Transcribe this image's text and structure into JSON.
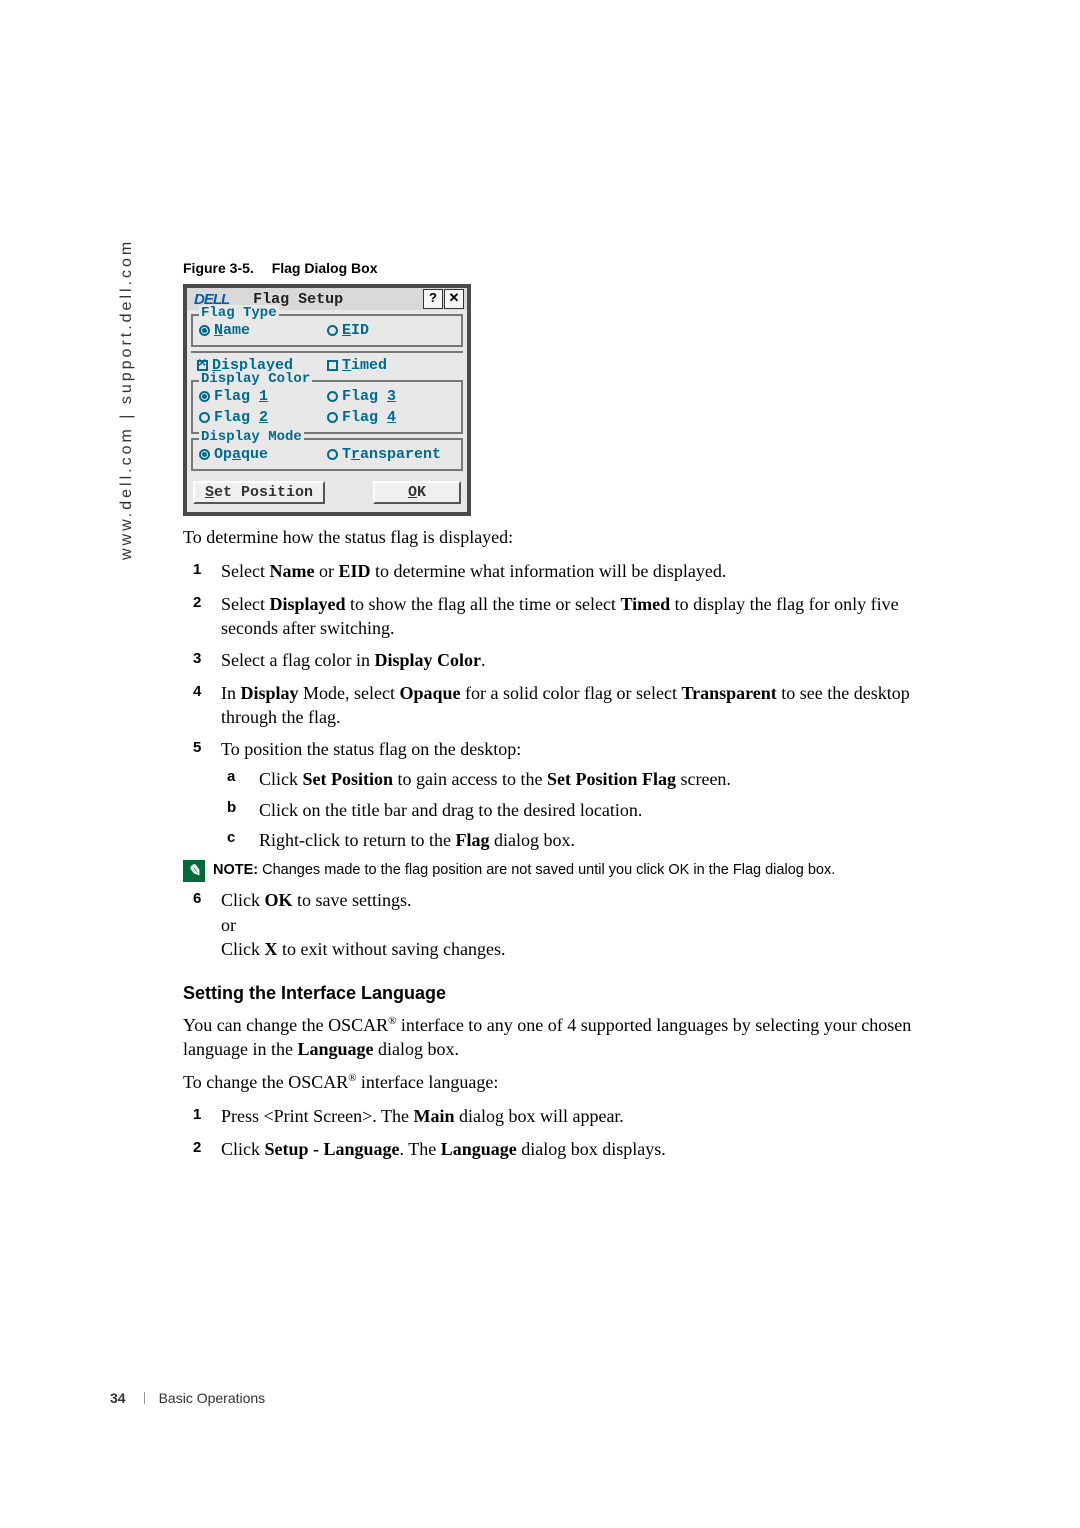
{
  "sidebar": "www.dell.com | support.dell.com",
  "figure": {
    "num": "Figure 3-5.",
    "title": "Flag Dialog Box"
  },
  "dialog": {
    "logo": "DELL",
    "title": "Flag Setup",
    "help": "?",
    "close": "✕",
    "flagType": {
      "legend": "Flag Type",
      "name_pre": "",
      "name_u": "N",
      "name_post": "ame",
      "eid_pre": "",
      "eid_u": "E",
      "eid_post": "ID",
      "disp_pre": "",
      "disp_u": "D",
      "disp_post": "isplayed",
      "timed_pre": "",
      "timed_u": "T",
      "timed_post": "imed"
    },
    "displayColor": {
      "legend": "Display Color",
      "f1": "Flag ",
      "n1": "1",
      "f2": "Flag ",
      "n2": "2",
      "f3": "Flag ",
      "n3": "3",
      "f4": "Flag ",
      "n4": "4"
    },
    "displayMode": {
      "legend": "Display Mode",
      "opaque_pre": "Op",
      "opaque_u": "a",
      "opaque_post": "que",
      "trans_pre": "T",
      "trans_u": "r",
      "trans_post": "ansparent"
    },
    "setPos_pre": "",
    "setPos_u": "S",
    "setPos_post": "et Position",
    "ok_pre": "",
    "ok_u": "O",
    "ok_post": "K"
  },
  "intro": "To determine how the status flag is displayed:",
  "steps": {
    "s1a": "Select ",
    "s1b": "Name",
    "s1c": " or ",
    "s1d": "EID",
    "s1e": " to determine what information will be displayed.",
    "s2a": "Select ",
    "s2b": "Displayed",
    "s2c": " to show the flag all the time or select ",
    "s2d": "Timed",
    "s2e": " to display the flag for only five seconds after switching.",
    "s3a": "Select a flag color in ",
    "s3b": "Display Color",
    "s3c": ".",
    "s4a": "In ",
    "s4b": "Display",
    "s4c": " Mode, select ",
    "s4d": "Opaque",
    "s4e": " for a solid color flag or select ",
    "s4f": "Transparent",
    "s4g": " to see the desktop through the flag.",
    "s5": "To position the status flag on the desktop:",
    "s5a_l": "a",
    "s5a_1": "Click ",
    "s5a_2": "Set Position",
    "s5a_3": " to gain access to the ",
    "s5a_4": "Set Position Flag",
    "s5a_5": " screen.",
    "s5b_l": "b",
    "s5b": "Click on the title bar and drag to the desired location.",
    "s5c_l": "c",
    "s5c_1": "Right-click to return to the ",
    "s5c_2": "Flag",
    "s5c_3": " dialog box.",
    "s6a": "Click ",
    "s6b": "OK",
    "s6c": " to save settings.",
    "s6or": "or",
    "s6d": "Click ",
    "s6e": "X",
    "s6f": " to exit without saving changes."
  },
  "note": {
    "lead": "NOTE:",
    "text_a": " Changes made to the flag position are not saved until you click ",
    "text_b": "OK",
    "text_c": " in the ",
    "text_d": "Flag",
    "text_e": " dialog box."
  },
  "section2": {
    "heading": "Setting the Interface Language",
    "p1a": "You can change the OSCAR",
    "reg": "®",
    "p1b": " interface to any one of 4 supported languages by selecting your chosen language in the ",
    "p1c": "Language",
    "p1d": " dialog box.",
    "p2a": "To change the OSCAR",
    "p2b": " interface language:",
    "st1a": "Press <Print Screen>. The ",
    "st1b": "Main",
    "st1c": " dialog box will appear.",
    "st2a": "Click ",
    "st2b": "Setup - Language",
    "st2c": ". The ",
    "st2d": "Language",
    "st2e": " dialog box displays."
  },
  "footer": {
    "page": "34",
    "section": "Basic Operations"
  }
}
